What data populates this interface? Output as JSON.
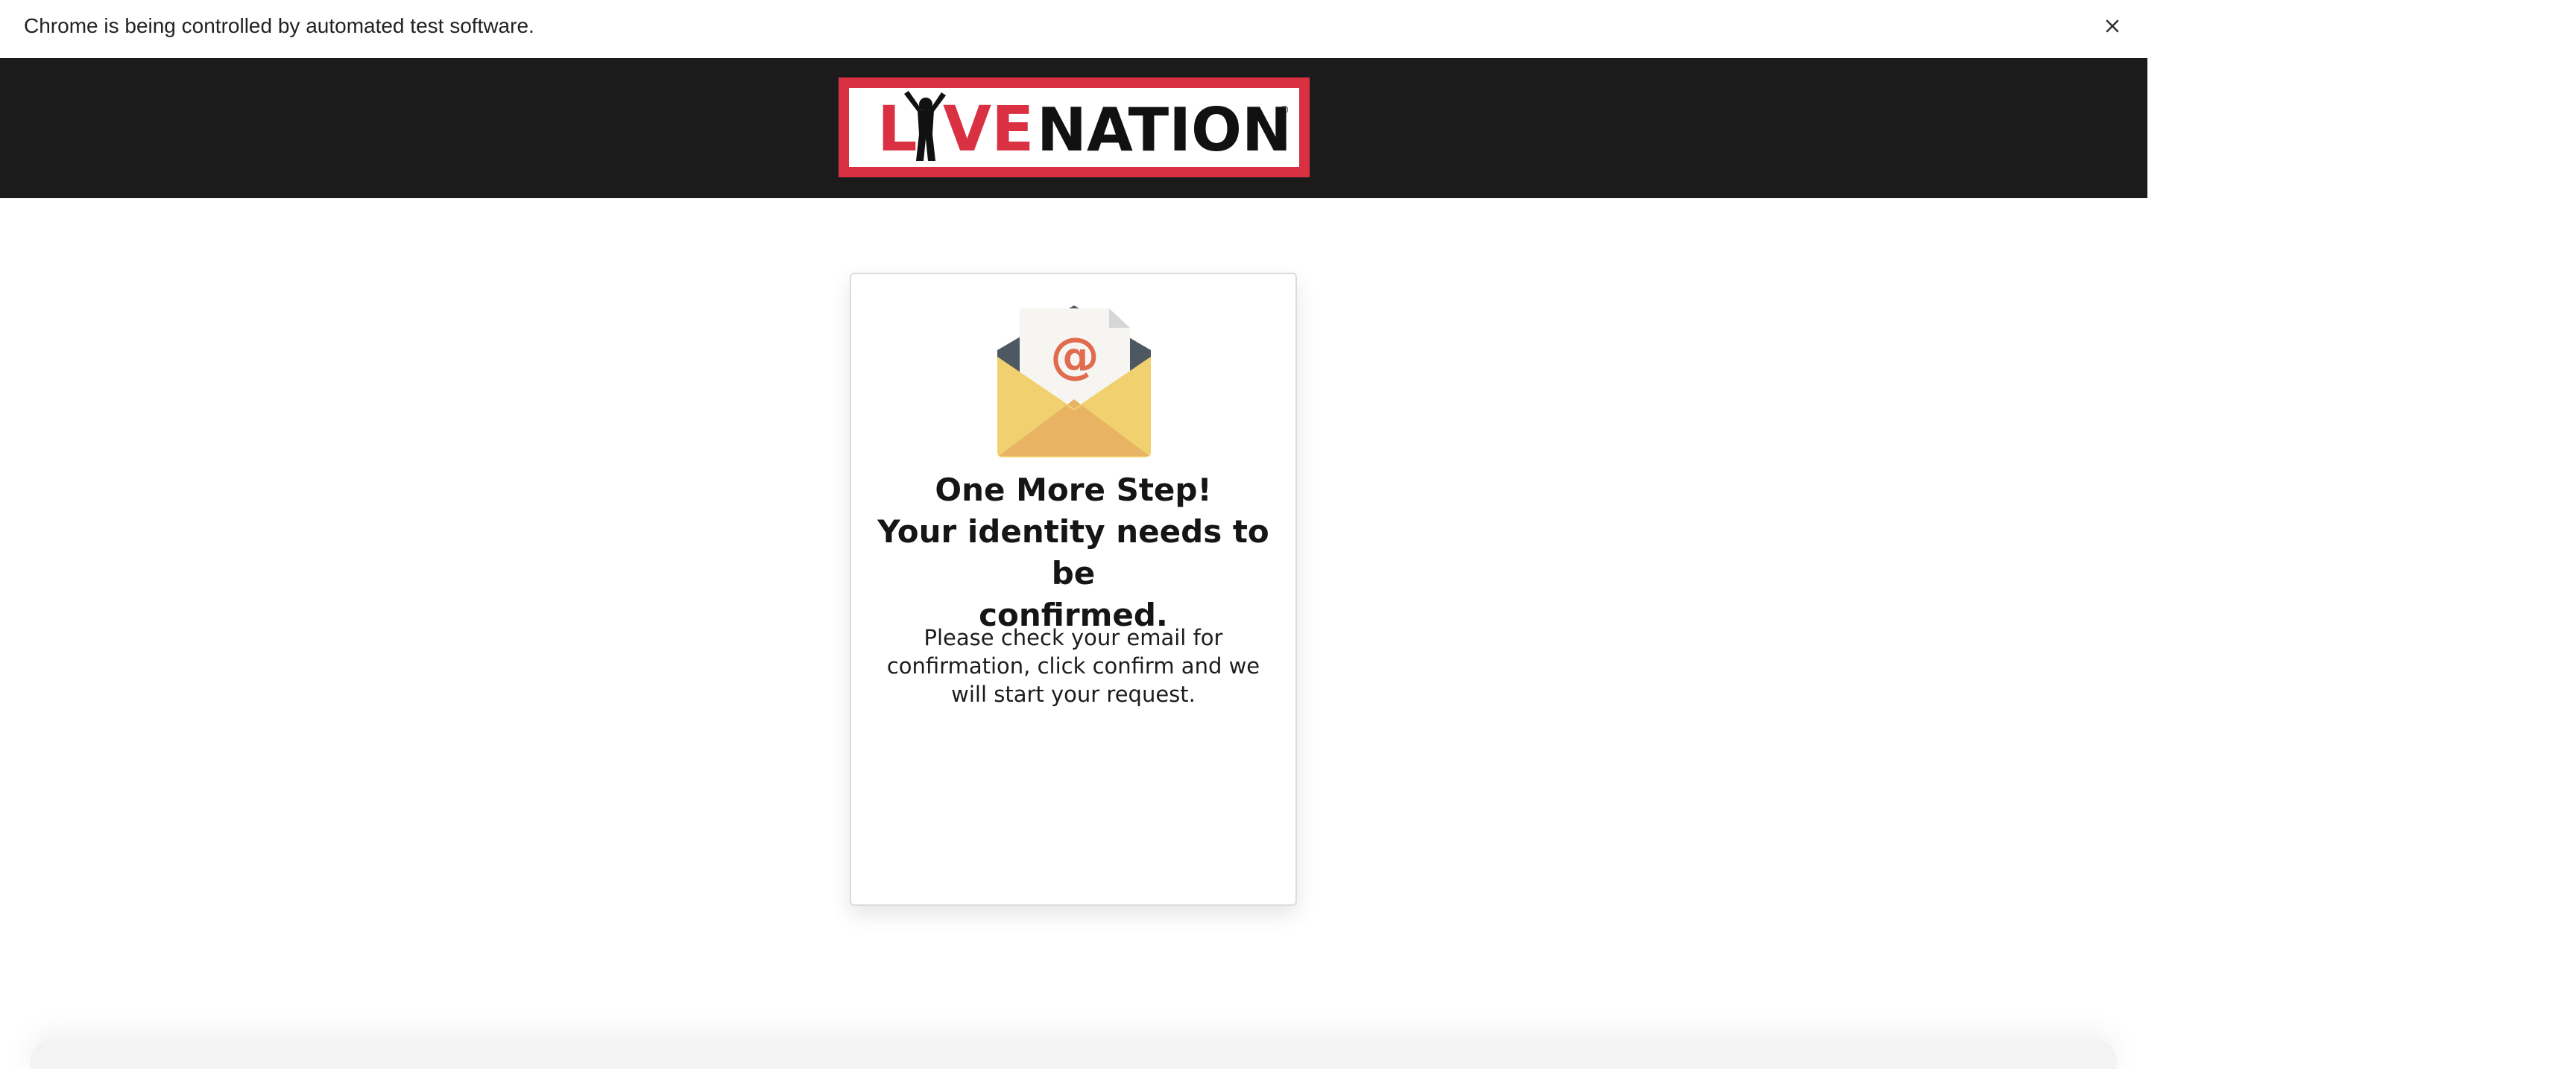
{
  "browser": {
    "infobar_text": "Chrome is being controlled by automated test software.",
    "close_icon": "close-icon"
  },
  "header": {
    "logo_text_left": "L",
    "logo_text_right": "VE",
    "logo_text_brand": "NATION",
    "logo_registered": "®",
    "background_color": "#1b1b1b",
    "logo_border_color": "#d93042",
    "logo_red_color": "#d93042"
  },
  "card": {
    "icon": "envelope-email-icon",
    "icon_symbol": "@",
    "heading_line1": "One More Step!",
    "heading_line2": "Your identity needs to be",
    "heading_line3": "confirmed.",
    "message": "Please check your email for confirmation, click confirm and we will start your request."
  }
}
